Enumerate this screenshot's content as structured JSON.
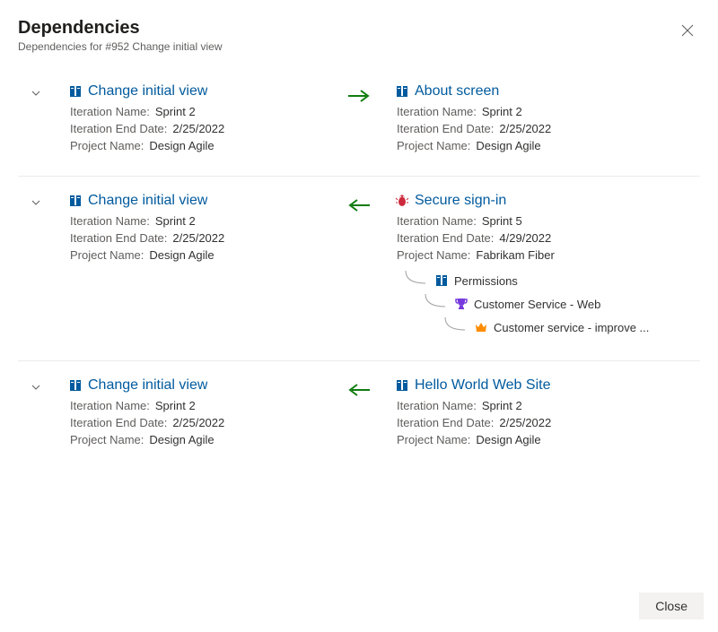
{
  "header": {
    "title": "Dependencies",
    "subtitle": "Dependencies for #952 Change initial view"
  },
  "labels": {
    "iterationName": "Iteration Name:",
    "iterationEndDate": "Iteration End Date:",
    "projectName": "Project Name:"
  },
  "rows": [
    {
      "direction": "right",
      "left": {
        "icon": "book",
        "title": "Change initial view",
        "iterationName": "Sprint 2",
        "iterationEndDate": "2/25/2022",
        "projectName": "Design Agile"
      },
      "right": {
        "icon": "book",
        "title": "About screen",
        "iterationName": "Sprint 2",
        "iterationEndDate": "2/25/2022",
        "projectName": "Design Agile"
      }
    },
    {
      "direction": "left",
      "left": {
        "icon": "book",
        "title": "Change initial view",
        "iterationName": "Sprint 2",
        "iterationEndDate": "2/25/2022",
        "projectName": "Design Agile"
      },
      "right": {
        "icon": "bug",
        "title": "Secure sign-in",
        "iterationName": "Sprint 5",
        "iterationEndDate": "4/29/2022",
        "projectName": "Fabrikam Fiber",
        "tree": [
          {
            "icon": "book",
            "label": "Permissions",
            "indent": 1
          },
          {
            "icon": "trophy",
            "label": "Customer Service - Web",
            "indent": 2
          },
          {
            "icon": "crown",
            "label": "Customer service - improve ...",
            "indent": 3
          }
        ]
      }
    },
    {
      "direction": "left",
      "left": {
        "icon": "book",
        "title": "Change initial view",
        "iterationName": "Sprint 2",
        "iterationEndDate": "2/25/2022",
        "projectName": "Design Agile"
      },
      "right": {
        "icon": "book",
        "title": "Hello World Web Site",
        "iterationName": "Sprint 2",
        "iterationEndDate": "2/25/2022",
        "projectName": "Design Agile"
      }
    }
  ],
  "footer": {
    "close": "Close"
  },
  "icons": {
    "book_color": "#005a9e",
    "bug_color": "#cc293d",
    "trophy_color": "#773adc",
    "crown_color": "#ff8c00"
  }
}
